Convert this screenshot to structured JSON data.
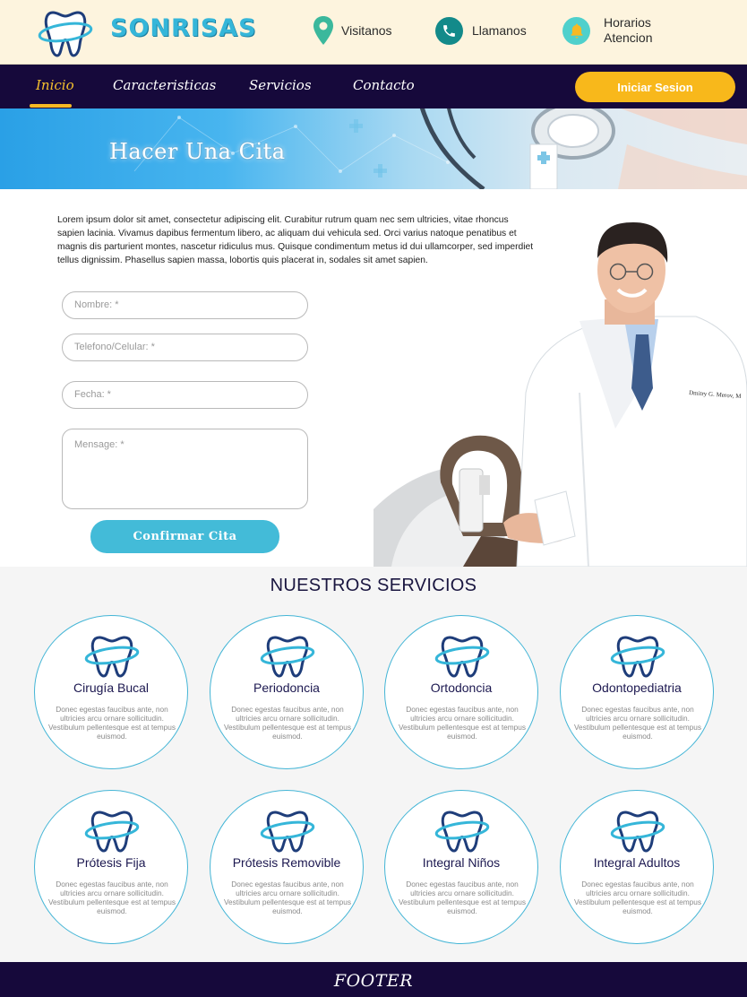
{
  "header": {
    "brand": "SONRISAS",
    "visit_label": "Visitanos",
    "call_label": "Llamanos",
    "hours_label_line1": "Horarios",
    "hours_label_line2": "Atencion"
  },
  "nav": {
    "items": [
      {
        "label": "Inicio",
        "active": true
      },
      {
        "label": "Caracteristicas",
        "active": false
      },
      {
        "label": "Servicios",
        "active": false
      },
      {
        "label": "Contacto",
        "active": false
      }
    ],
    "login_label": "Iniciar Sesion"
  },
  "banner": {
    "title": "Hacer Una Cita"
  },
  "form": {
    "intro": "Lorem ipsum dolor sit amet, consectetur adipiscing elit. Curabitur rutrum quam nec sem ultricies, vitae rhoncus sapien lacinia. Vivamus dapibus fermentum libero, ac aliquam dui vehicula sed. Orci varius natoque penatibus et magnis dis parturient montes, nascetur ridiculus mus. Quisque condimentum metus id dui ullamcorper, sed imperdiet tellus dignissim. Phasellus sapien massa, lobortis quis placerat in, sodales sit amet sapien.",
    "name_placeholder": "Nombre: *",
    "phone_placeholder": "Telefono/Celular: *",
    "date_placeholder": "Fecha: *",
    "message_placeholder": "Mensage: *",
    "submit_label": "Confirmar Cita",
    "doctor_coat_text": "Dmitry G. Merov, M"
  },
  "services": {
    "title": "NUESTROS SERVICIOS",
    "items": [
      {
        "name": "Cirugía Bucal",
        "desc": "Donec egestas faucibus ante, non ultricies arcu ornare sollicitudin. Vestibulum pellentesque est at tempus euismod."
      },
      {
        "name": "Periodoncia",
        "desc": "Donec egestas faucibus ante, non ultricies arcu ornare sollicitudin. Vestibulum pellentesque est at tempus euismod."
      },
      {
        "name": "Ortodoncia",
        "desc": "Donec egestas faucibus ante, non ultricies arcu ornare sollicitudin. Vestibulum pellentesque est at tempus euismod."
      },
      {
        "name": "Odontopediatria",
        "desc": "Donec egestas faucibus ante, non ultricies arcu ornare sollicitudin. Vestibulum pellentesque est at tempus euismod."
      },
      {
        "name": "Prótesis Fija",
        "desc": "Donec egestas faucibus ante, non ultricies arcu ornare sollicitudin. Vestibulum pellentesque est at tempus euismod."
      },
      {
        "name": "Prótesis Removible",
        "desc": "Donec egestas faucibus ante, non ultricies arcu ornare sollicitudin. Vestibulum pellentesque est at tempus euismod."
      },
      {
        "name": "Integral Niños",
        "desc": "Donec egestas faucibus ante, non ultricies arcu ornare sollicitudin. Vestibulum pellentesque est at tempus euismod."
      },
      {
        "name": "Integral Adultos",
        "desc": "Donec egestas faucibus ante, non ultricies arcu ornare sollicitudin. Vestibulum pellentesque est at tempus euismod."
      }
    ]
  },
  "footer": {
    "label": "FOOTER"
  },
  "colors": {
    "nav_bg": "#16093b",
    "accent_yellow": "#f8b81b",
    "accent_cyan": "#43bbd8",
    "header_bg": "#fdf4de"
  },
  "icons": [
    "tooth-logo-icon",
    "location-pin-icon",
    "phone-icon",
    "bell-icon",
    "tooth-icon"
  ]
}
